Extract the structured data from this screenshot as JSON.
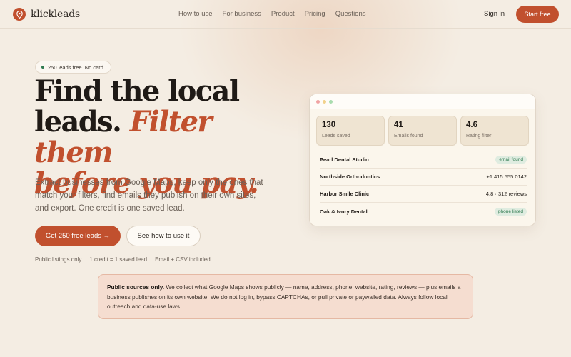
{
  "nav": {
    "brand": "klickleads",
    "links": [
      "How to use",
      "For business",
      "Product",
      "Pricing",
      "Questions"
    ],
    "signin": "Sign in",
    "start": "Start free"
  },
  "hero": {
    "pill": "250 leads free. No card.",
    "headline_line1": "Find the local",
    "headline_line2a": "leads.",
    "headline_line2b": "Filter them",
    "headline_line3": "before you pay.",
    "subtext": "Extract businesses from Google Maps, keep only the ones that match your filters, find emails they publish on their own sites, and export. One credit is one saved lead.",
    "cta_primary": "Get 250 free leads →",
    "cta_secondary": "See how to use it",
    "features": [
      "Public listings only",
      "1 credit = 1 saved lead",
      "Email + CSV included"
    ]
  },
  "dashboard": {
    "stats": [
      {
        "value": "130",
        "label": "Leads saved"
      },
      {
        "value": "41",
        "label": "Emails found"
      },
      {
        "value": "4.6",
        "label": "Rating filter"
      }
    ],
    "rows": [
      {
        "name": "Pearl Dental Studio",
        "meta": "email found",
        "badge": true
      },
      {
        "name": "Northside Orthodontics",
        "meta": "+1 415 555 0142",
        "badge": false
      },
      {
        "name": "Harbor Smile Clinic",
        "meta": "4.8 · 312 reviews",
        "badge": false
      },
      {
        "name": "Oak & Ivory Dental",
        "meta": "phone listed",
        "badge": true
      }
    ]
  },
  "notice": {
    "title": "Public sources only.",
    "body": " We collect what Google Maps shows publicly — name, address, phone, website, rating, reviews — plus emails a business publishes on its own website. We do not log in, bypass CAPTCHAs, or pull private or paywalled data. Always follow local outreach and data-use laws."
  },
  "colors": {
    "accent": "#c1502e",
    "background": "#f4ede3",
    "badge_green": "#2f7a50"
  }
}
